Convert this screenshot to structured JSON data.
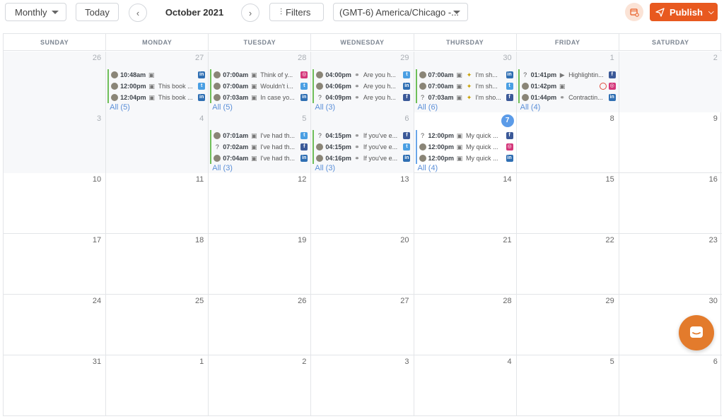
{
  "toolbar": {
    "view_label": "Monthly",
    "today_label": "Today",
    "month_title": "October 2021",
    "filters_label": "Filters",
    "timezone": "(GMT-6) America/Chicago -...",
    "publish_label": "Publish"
  },
  "colors": {
    "accent": "#e8591f",
    "today_badge": "#5b9be8",
    "published_bar": "#6fbf59",
    "scheduled_bar": "#6aa6e8"
  },
  "weekdays": [
    "SUNDAY",
    "MONDAY",
    "TUESDAY",
    "WEDNESDAY",
    "THURSDAY",
    "FRIDAY",
    "SATURDAY"
  ],
  "weeks": [
    [
      {
        "num": "26",
        "past": true
      },
      {
        "num": "27",
        "past": true,
        "posts": [
          {
            "avatar": true,
            "time": "10:48am",
            "media": "image-icon",
            "text": "",
            "network": "linkedin",
            "bar": "green"
          },
          {
            "avatar": true,
            "time": "12:00pm",
            "media": "image-icon",
            "text": "This book ...",
            "network": "twitter",
            "bar": "green"
          },
          {
            "avatar": true,
            "time": "12:04pm",
            "media": "image-icon",
            "text": "This book ...",
            "network": "linkedin",
            "bar": "green"
          }
        ],
        "all": "All (5)"
      },
      {
        "num": "28",
        "past": true,
        "posts": [
          {
            "avatar": true,
            "time": "07:00am",
            "media": "image-icon",
            "text": "Think of y...",
            "network": "instagram",
            "bar": "green"
          },
          {
            "avatar": true,
            "time": "07:00am",
            "media": "image-icon",
            "text": "Wouldn't i...",
            "network": "twitter",
            "bar": "green"
          },
          {
            "avatar": true,
            "time": "07:03am",
            "media": "image-icon",
            "text": "In case yo...",
            "network": "linkedin",
            "bar": "green"
          }
        ],
        "all": "All (5)"
      },
      {
        "num": "29",
        "past": true,
        "posts": [
          {
            "avatar": true,
            "time": "04:00pm",
            "media": "link-icon",
            "text": "Are you h...",
            "network": "twitter",
            "bar": "green"
          },
          {
            "avatar": true,
            "time": "04:06pm",
            "media": "link-icon",
            "text": "Are you h...",
            "network": "linkedin",
            "bar": "green"
          },
          {
            "avatar": false,
            "time": "04:09pm",
            "media": "link-icon",
            "text": "Are you h...",
            "network": "facebook",
            "bar": "green"
          }
        ],
        "all": "All (3)"
      },
      {
        "num": "30",
        "past": true,
        "posts": [
          {
            "avatar": true,
            "time": "07:00am",
            "media": "image-icon",
            "text": "I'm sh...",
            "extra": "bee",
            "network": "linkedin",
            "bar": "green"
          },
          {
            "avatar": true,
            "time": "07:00am",
            "media": "image-icon",
            "text": "I'm sh...",
            "extra": "bee",
            "network": "twitter",
            "bar": "green"
          },
          {
            "avatar": false,
            "time": "07:03am",
            "media": "image-icon",
            "text": "I'm sho...",
            "extra": "bee",
            "network": "facebook",
            "bar": "green"
          }
        ],
        "all": "All (6)"
      },
      {
        "num": "1",
        "past": true,
        "posts": [
          {
            "avatar": false,
            "time": "01:41pm",
            "media": "video-icon",
            "text": "Highlightin...",
            "network": "facebook",
            "bar": "green"
          },
          {
            "avatar": true,
            "time": "01:42pm",
            "media": "image-icon",
            "text": "",
            "error": true,
            "network": "instagram",
            "bar": "green"
          },
          {
            "avatar": true,
            "time": "01:44pm",
            "media": "link-icon",
            "text": "Contractin...",
            "network": "linkedin",
            "bar": "green"
          }
        ],
        "all": "All (4)"
      },
      {
        "num": "2",
        "past": true
      }
    ],
    [
      {
        "num": "3",
        "past": true
      },
      {
        "num": "4",
        "past": true
      },
      {
        "num": "5",
        "past": true,
        "posts": [
          {
            "avatar": true,
            "time": "07:01am",
            "media": "image-icon",
            "text": "I've had th...",
            "network": "twitter",
            "bar": "green"
          },
          {
            "avatar": false,
            "time": "07:02am",
            "media": "image-icon",
            "text": "I've had th...",
            "network": "facebook",
            "bar": "green"
          },
          {
            "avatar": true,
            "time": "07:04am",
            "media": "image-icon",
            "text": "I've had th...",
            "network": "linkedin",
            "bar": "green"
          }
        ],
        "all": "All (3)"
      },
      {
        "num": "6",
        "past": true,
        "posts": [
          {
            "avatar": false,
            "time": "04:15pm",
            "media": "link-icon",
            "text": "If you've e...",
            "network": "facebook",
            "bar": "green"
          },
          {
            "avatar": true,
            "time": "04:15pm",
            "media": "link-icon",
            "text": "If you've e...",
            "network": "twitter",
            "bar": "green"
          },
          {
            "avatar": true,
            "time": "04:16pm",
            "media": "link-icon",
            "text": "If you've e...",
            "network": "linkedin",
            "bar": "green"
          }
        ],
        "all": "All (3)"
      },
      {
        "num": "7",
        "today": true,
        "posts": [
          {
            "avatar": false,
            "time": "12:00pm",
            "media": "image-icon",
            "text": "My quick ...",
            "network": "facebook",
            "bar": "blue"
          },
          {
            "avatar": true,
            "time": "12:00pm",
            "media": "image-icon",
            "text": "My quick ...",
            "network": "instagram",
            "bar": "blue"
          },
          {
            "avatar": true,
            "time": "12:00pm",
            "media": "image-icon",
            "text": "My quick ...",
            "network": "linkedin",
            "bar": "blue"
          }
        ],
        "all": "All (4)"
      },
      {
        "num": "8"
      },
      {
        "num": "9"
      }
    ],
    [
      {
        "num": "10"
      },
      {
        "num": "11"
      },
      {
        "num": "12"
      },
      {
        "num": "13"
      },
      {
        "num": "14"
      },
      {
        "num": "15"
      },
      {
        "num": "16"
      }
    ],
    [
      {
        "num": "17"
      },
      {
        "num": "18"
      },
      {
        "num": "19"
      },
      {
        "num": "20"
      },
      {
        "num": "21"
      },
      {
        "num": "22"
      },
      {
        "num": "23"
      }
    ],
    [
      {
        "num": "24"
      },
      {
        "num": "25"
      },
      {
        "num": "26"
      },
      {
        "num": "27"
      },
      {
        "num": "28"
      },
      {
        "num": "29"
      },
      {
        "num": "30"
      }
    ],
    [
      {
        "num": "31"
      },
      {
        "num": "1"
      },
      {
        "num": "2"
      },
      {
        "num": "3"
      },
      {
        "num": "4"
      },
      {
        "num": "5"
      },
      {
        "num": "6"
      }
    ]
  ]
}
